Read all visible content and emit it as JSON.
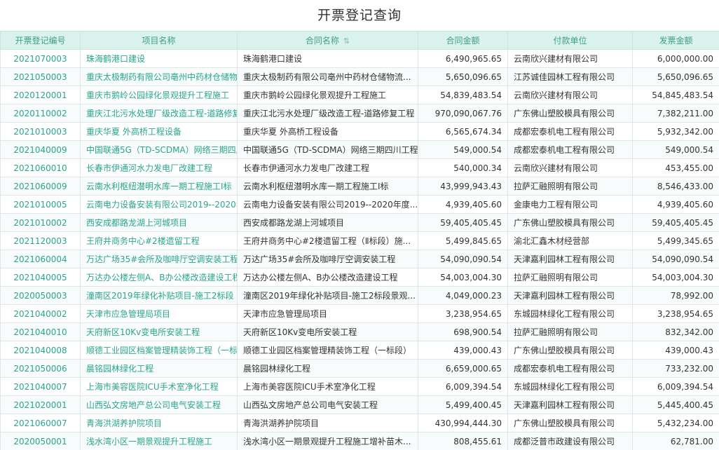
{
  "title": "开票登记查询",
  "columns": {
    "no": "开票登记编号",
    "project": "项目名称",
    "contract": "合同名称",
    "amount": "合同金额",
    "payer": "付款单位",
    "invoice": "发票金额"
  },
  "rows": [
    {
      "no": "2021070003",
      "project": "珠海鹤港口建设",
      "contract": "珠海鹤港口建设",
      "amount": "6,490,965.65",
      "payer": "云南欣兴建材有限公司",
      "invoice": "6,000,000.00"
    },
    {
      "no": "2021050003",
      "project": "重庆太极制药有限公司亳州中药材仓储物",
      "contract": "重庆太极制药有限公司亳州中药材仓储物流...",
      "amount": "5,650,096.65",
      "payer": "江苏诚佳园林工程有限公司",
      "invoice": "5,650,096.65"
    },
    {
      "no": "2020120001",
      "project": "重庆市鹅岭公园绿化景观提升工程施工",
      "contract": "重庆市鹅岭公园绿化景观提升工程施工",
      "amount": "54,839,483.54",
      "payer": "云南欣兴建材有限公司",
      "invoice": "54,845,483.54"
    },
    {
      "no": "2020110002",
      "project": "重庆江北污水处理厂级改造工程-道路修复",
      "contract": "重庆江北污水处理厂级改造工程-道路修复工程",
      "amount": "970,090,067.76",
      "payer": "广东佛山塑胶模具有限公司",
      "invoice": "7,382,211.00"
    },
    {
      "no": "2021010003",
      "project": "重庆华夏 外高桥工程设备",
      "contract": "重庆华夏 外高桥工程设备",
      "amount": "6,565,674.34",
      "payer": "成都宏泰机电工程有限公司",
      "invoice": "5,932,342.00"
    },
    {
      "no": "2021040009",
      "project": "中国联通5G（TD-SCDMA）网络三期四川",
      "contract": "中国联通5G（TD-SCDMA）网络三期四川工程",
      "amount": "549,000.54",
      "payer": "成都宏泰机电工程有限公司",
      "invoice": "549,000.54"
    },
    {
      "no": "2021060010",
      "project": "长春市伊通河水力发电厂改建工程",
      "contract": "长春市伊通河水力发电厂改建工程",
      "amount": "540,000.34",
      "payer": "云南欣兴建材有限公司",
      "invoice": "453,455.00"
    },
    {
      "no": "2021060009",
      "project": "云南水利枢纽潜明水库一期工程施工Ⅰ标",
      "contract": "云南水利枢纽潜明水库一期工程施工Ⅰ标",
      "amount": "43,999,943.43",
      "payer": "拉萨汇融照明有限公司",
      "invoice": "8,546,433.00"
    },
    {
      "no": "2021010005",
      "project": "云南电力设备安装有限公司2019--2020年",
      "contract": "云南电力设备安装有限公司2019--2020年度...",
      "amount": "4,939,405.60",
      "payer": "金康电力工程有限公司",
      "invoice": "4,939,405.60"
    },
    {
      "no": "2021010002",
      "project": "西安成都路龙湖上河城项目",
      "contract": "西安成都路龙湖上河城项目",
      "amount": "59,405,405.45",
      "payer": "广东佛山塑胶模具有限公司",
      "invoice": "59,405,405.45"
    },
    {
      "no": "2021120003",
      "project": "王府井商务中心#2楼遗留工程",
      "contract": "王府井商务中心#2楼遗留工程（Ⅱ标段）施...",
      "amount": "5,499,845.65",
      "payer": "渝北汇鑫木材经营部",
      "invoice": "5,499,345.65"
    },
    {
      "no": "2021060004",
      "project": "万达广场35#会所及咖啡厅空调安装工程",
      "contract": "万达广场35#会所及咖啡厅空调安装工程",
      "amount": "54,090,090.54",
      "payer": "天津嘉利园林工程有限公司",
      "invoice": "54,090,090.54"
    },
    {
      "no": "2021040005",
      "project": "万达办公楼左侧A、B办公楼改造建设工程",
      "contract": "万达办公楼左侧A、B办公楼改造建设工程",
      "amount": "54,003,004.30",
      "payer": "拉萨汇融照明有限公司",
      "invoice": "54,003,004.30"
    },
    {
      "no": "2020050003",
      "project": "潼南区2019年绿化补贴项目-施工2标段",
      "contract": "潼南区2019年绿化补贴项目-施工2标段景观...",
      "amount": "4,049,000.23",
      "payer": "天津嘉利园林工程有限公司",
      "invoice": "78,992.00"
    },
    {
      "no": "2021040002",
      "project": "天津市应急管理局项目",
      "contract": "天津市应急管理局项目",
      "amount": "3,238,954.65",
      "payer": "东城园林绿化工程有限公司",
      "invoice": "3,238,954.65"
    },
    {
      "no": "2021040010",
      "project": "天府新区10Kv变电所安装工程",
      "contract": "天府新区10Kv变电所安装工程",
      "amount": "698,900.54",
      "payer": "拉萨汇融照明有限公司",
      "invoice": "832,342.00"
    },
    {
      "no": "2021040008",
      "project": "顺德工业园区档案管理精装饰工程（一标",
      "contract": "顺德工业园区档案管理精装饰工程（一标段）",
      "amount": "439,000.43",
      "payer": "广东佛山塑胶模具有限公司",
      "invoice": "439,000.43"
    },
    {
      "no": "2021050006",
      "project": "晨铭园林绿化工程",
      "contract": "晨铭园林绿化工程",
      "amount": "6,659,000.65",
      "payer": "成都宏泰机电工程有限公司",
      "invoice": "733,232.00"
    },
    {
      "no": "2021040007",
      "project": "上海市美容医院ICU手术室净化工程",
      "contract": "上海市美容医院ICU手术室净化工程",
      "amount": "6,009,394.54",
      "payer": "东城园林绿化工程有限公司",
      "invoice": "6,009,394.54"
    },
    {
      "no": "2021020001",
      "project": "山西弘文房地产总公司电气安装工程",
      "contract": "山西弘文房地产总公司电气安装工程",
      "amount": "5,499,400.45",
      "payer": "天津嘉利园林工程有限公司",
      "invoice": "5,445,400.45"
    },
    {
      "no": "2021060007",
      "project": "青海洪湖养护院项目",
      "contract": "青海洪湖养护院项目",
      "amount": "430,994,444.30",
      "payer": "广东佛山塑胶模具有限公司",
      "invoice": "5,432,234.00"
    },
    {
      "no": "2020050001",
      "project": "浅水湾小区一期景观提升工程施工",
      "contract": "浅水湾小区一期景观提升工程施工增补苗木...",
      "amount": "808,455.61",
      "payer": "成都泛普市政建设有限公司",
      "invoice": "62,781.00"
    }
  ]
}
